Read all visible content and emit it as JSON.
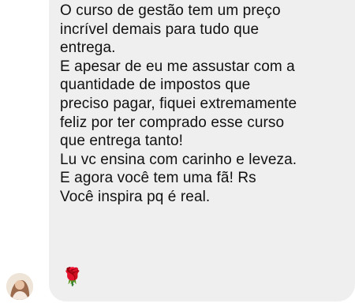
{
  "message": {
    "paragraphs": [
      "O curso de gestão tem um preço\nincrível demais para tudo que\nentrega.",
      "E apesar de eu me assustar com a\nquantidade de impostos que\npreciso pagar, fiquei extremamente\nfeliz por ter comprado esse curso\nque entrega tanto!",
      "Lu vc ensina com carinho e leveza.",
      "E agora você tem uma fã! Rs",
      "Você inspira pq é real."
    ],
    "reaction_emoji": "🌹"
  },
  "sender": {
    "avatar_icon": "profile-photo-avatar"
  },
  "colors": {
    "bubble_background": "#efefef",
    "text": "#111111"
  }
}
